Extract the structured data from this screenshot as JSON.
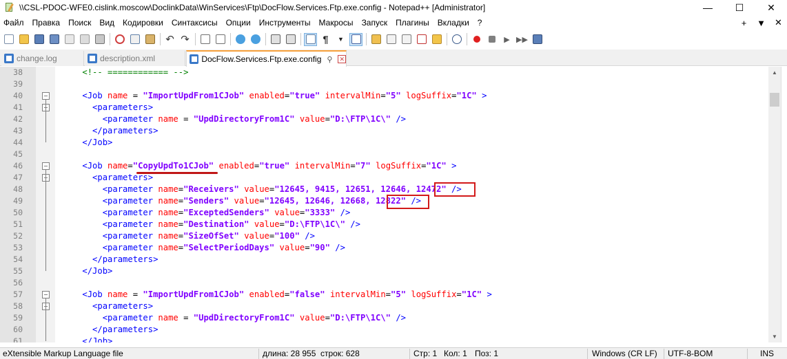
{
  "window": {
    "title": "\\\\CSL-PDOC-WFE0.cislink.moscow\\DoclinkData\\WinServices\\Ftp\\DocFlow.Services.Ftp.exe.config - Notepad++ [Administrator]",
    "minimize": "—",
    "maximize": "☐",
    "close": "✕"
  },
  "menu": {
    "items": [
      "Файл",
      "Правка",
      "Поиск",
      "Вид",
      "Кодировки",
      "Синтаксисы",
      "Опции",
      "Инструменты",
      "Макросы",
      "Запуск",
      "Плагины",
      "Вкладки",
      "?"
    ],
    "right": [
      "+",
      "▼",
      "✕"
    ]
  },
  "tabs": [
    {
      "label": "change.log",
      "active": false
    },
    {
      "label": "description.xml",
      "active": false
    },
    {
      "label": "DocFlow.Services.Ftp.exe.config",
      "active": true
    }
  ],
  "editor": {
    "lines": [
      {
        "n": "38",
        "indent": "    ",
        "parts": [
          [
            "c-com",
            "<!-- ============ -->"
          ]
        ]
      },
      {
        "n": "39",
        "indent": "",
        "parts": []
      },
      {
        "n": "40",
        "indent": "    ",
        "parts": [
          [
            "c-tag",
            "<Job "
          ],
          [
            "c-attr",
            "name"
          ],
          [
            "c-eq",
            " = "
          ],
          [
            "c-val",
            "\"ImportUpdFrom1CJob\""
          ],
          [
            "c-eq",
            " "
          ],
          [
            "c-attr",
            "enabled"
          ],
          [
            "c-eq",
            "="
          ],
          [
            "c-val",
            "\"true\""
          ],
          [
            "c-eq",
            " "
          ],
          [
            "c-attr",
            "intervalMin"
          ],
          [
            "c-eq",
            "="
          ],
          [
            "c-val",
            "\"5\""
          ],
          [
            "c-eq",
            " "
          ],
          [
            "c-attr",
            "logSuffix"
          ],
          [
            "c-eq",
            "="
          ],
          [
            "c-val",
            "\"1C\""
          ],
          [
            "c-tag",
            " >"
          ]
        ]
      },
      {
        "n": "41",
        "indent": "      ",
        "parts": [
          [
            "c-tag",
            "<parameters>"
          ]
        ]
      },
      {
        "n": "42",
        "indent": "        ",
        "parts": [
          [
            "c-tag",
            "<parameter "
          ],
          [
            "c-attr",
            "name"
          ],
          [
            "c-eq",
            " = "
          ],
          [
            "c-val",
            "\"UpdDirectoryFrom1C\""
          ],
          [
            "c-eq",
            " "
          ],
          [
            "c-attr",
            "value"
          ],
          [
            "c-eq",
            "="
          ],
          [
            "c-val",
            "\"D:\\FTP\\1C\\\""
          ],
          [
            "c-tag",
            " />"
          ]
        ]
      },
      {
        "n": "43",
        "indent": "      ",
        "parts": [
          [
            "c-tag",
            "</parameters>"
          ]
        ]
      },
      {
        "n": "44",
        "indent": "    ",
        "parts": [
          [
            "c-tag",
            "</Job>"
          ]
        ]
      },
      {
        "n": "45",
        "indent": "",
        "parts": []
      },
      {
        "n": "46",
        "indent": "    ",
        "parts": [
          [
            "c-tag",
            "<Job "
          ],
          [
            "c-attr",
            "name"
          ],
          [
            "c-eq",
            "="
          ],
          [
            "c-val",
            "\"CopyUpdTo1CJob\""
          ],
          [
            "c-eq",
            " "
          ],
          [
            "c-attr",
            "enabled"
          ],
          [
            "c-eq",
            "="
          ],
          [
            "c-val",
            "\"true\""
          ],
          [
            "c-eq",
            " "
          ],
          [
            "c-attr",
            "intervalMin"
          ],
          [
            "c-eq",
            "="
          ],
          [
            "c-val",
            "\"7\""
          ],
          [
            "c-eq",
            " "
          ],
          [
            "c-attr",
            "logSuffix"
          ],
          [
            "c-eq",
            "="
          ],
          [
            "c-val",
            "\"1C\""
          ],
          [
            "c-tag",
            " >"
          ]
        ]
      },
      {
        "n": "47",
        "indent": "      ",
        "parts": [
          [
            "c-tag",
            "<parameters>"
          ]
        ]
      },
      {
        "n": "48",
        "indent": "        ",
        "parts": [
          [
            "c-tag",
            "<parameter "
          ],
          [
            "c-attr",
            "name"
          ],
          [
            "c-eq",
            "="
          ],
          [
            "c-val",
            "\"Receivers\""
          ],
          [
            "c-eq",
            " "
          ],
          [
            "c-attr",
            "value"
          ],
          [
            "c-eq",
            "="
          ],
          [
            "c-val",
            "\"12645, 9415, 12651, 12646, 12472\""
          ],
          [
            "c-tag",
            " />"
          ]
        ]
      },
      {
        "n": "49",
        "indent": "        ",
        "parts": [
          [
            "c-tag",
            "<parameter "
          ],
          [
            "c-attr",
            "name"
          ],
          [
            "c-eq",
            "="
          ],
          [
            "c-val",
            "\"Senders\""
          ],
          [
            "c-eq",
            " "
          ],
          [
            "c-attr",
            "value"
          ],
          [
            "c-eq",
            "="
          ],
          [
            "c-val",
            "\"12645, 12646, 12668, 12822\""
          ],
          [
            "c-tag",
            " />"
          ]
        ]
      },
      {
        "n": "50",
        "indent": "        ",
        "parts": [
          [
            "c-tag",
            "<parameter "
          ],
          [
            "c-attr",
            "name"
          ],
          [
            "c-eq",
            "="
          ],
          [
            "c-val",
            "\"ExceptedSenders\""
          ],
          [
            "c-eq",
            " "
          ],
          [
            "c-attr",
            "value"
          ],
          [
            "c-eq",
            "="
          ],
          [
            "c-val",
            "\"3333\""
          ],
          [
            "c-tag",
            " />"
          ]
        ]
      },
      {
        "n": "51",
        "indent": "        ",
        "parts": [
          [
            "c-tag",
            "<parameter "
          ],
          [
            "c-attr",
            "name"
          ],
          [
            "c-eq",
            "="
          ],
          [
            "c-val",
            "\"Destination\""
          ],
          [
            "c-eq",
            " "
          ],
          [
            "c-attr",
            "value"
          ],
          [
            "c-eq",
            "="
          ],
          [
            "c-val",
            "\"D:\\FTP\\1C\\\""
          ],
          [
            "c-tag",
            " />"
          ]
        ]
      },
      {
        "n": "52",
        "indent": "        ",
        "parts": [
          [
            "c-tag",
            "<parameter "
          ],
          [
            "c-attr",
            "name"
          ],
          [
            "c-eq",
            "="
          ],
          [
            "c-val",
            "\"SizeOfSet\""
          ],
          [
            "c-eq",
            " "
          ],
          [
            "c-attr",
            "value"
          ],
          [
            "c-eq",
            "="
          ],
          [
            "c-val",
            "\"100\""
          ],
          [
            "c-tag",
            " />"
          ]
        ]
      },
      {
        "n": "53",
        "indent": "        ",
        "parts": [
          [
            "c-tag",
            "<parameter "
          ],
          [
            "c-attr",
            "name"
          ],
          [
            "c-eq",
            "="
          ],
          [
            "c-val",
            "\"SelectPeriodDays\""
          ],
          [
            "c-eq",
            " "
          ],
          [
            "c-attr",
            "value"
          ],
          [
            "c-eq",
            "="
          ],
          [
            "c-val",
            "\"90\""
          ],
          [
            "c-tag",
            " />"
          ]
        ]
      },
      {
        "n": "54",
        "indent": "      ",
        "parts": [
          [
            "c-tag",
            "</parameters>"
          ]
        ]
      },
      {
        "n": "55",
        "indent": "    ",
        "parts": [
          [
            "c-tag",
            "</Job>"
          ]
        ]
      },
      {
        "n": "56",
        "indent": "",
        "parts": []
      },
      {
        "n": "57",
        "indent": "    ",
        "parts": [
          [
            "c-tag",
            "<Job "
          ],
          [
            "c-attr",
            "name"
          ],
          [
            "c-eq",
            " = "
          ],
          [
            "c-val",
            "\"ImportUpdFrom1CJob\""
          ],
          [
            "c-eq",
            " "
          ],
          [
            "c-attr",
            "enabled"
          ],
          [
            "c-eq",
            "="
          ],
          [
            "c-val",
            "\"false\""
          ],
          [
            "c-eq",
            " "
          ],
          [
            "c-attr",
            "intervalMin"
          ],
          [
            "c-eq",
            "="
          ],
          [
            "c-val",
            "\"5\""
          ],
          [
            "c-eq",
            " "
          ],
          [
            "c-attr",
            "logSuffix"
          ],
          [
            "c-eq",
            "="
          ],
          [
            "c-val",
            "\"1C\""
          ],
          [
            "c-tag",
            " >"
          ]
        ]
      },
      {
        "n": "58",
        "indent": "      ",
        "parts": [
          [
            "c-tag",
            "<parameters>"
          ]
        ]
      },
      {
        "n": "59",
        "indent": "        ",
        "parts": [
          [
            "c-tag",
            "<parameter "
          ],
          [
            "c-attr",
            "name"
          ],
          [
            "c-eq",
            " = "
          ],
          [
            "c-val",
            "\"UpdDirectoryFrom1C\""
          ],
          [
            "c-eq",
            " "
          ],
          [
            "c-attr",
            "value"
          ],
          [
            "c-eq",
            "="
          ],
          [
            "c-val",
            "\"D:\\FTP\\1C\\\""
          ],
          [
            "c-tag",
            " />"
          ]
        ]
      },
      {
        "n": "60",
        "indent": "      ",
        "parts": [
          [
            "c-tag",
            "</parameters>"
          ]
        ]
      },
      {
        "n": "61",
        "indent": "    ",
        "parts": [
          [
            "c-tag",
            "</Job>"
          ]
        ]
      }
    ]
  },
  "status": {
    "file_type": "eXtensible Markup Language file",
    "length": "длина: 28 955",
    "lines": "строк: 628",
    "line": "Стр: 1",
    "col": "Кол: 1",
    "pos": "Поз: 1",
    "eol": "Windows (CR LF)",
    "encoding": "UTF-8-BOM",
    "mode": "INS"
  },
  "colors": {
    "highlight": "#d21919",
    "tab_accent": "#f7a03a"
  }
}
